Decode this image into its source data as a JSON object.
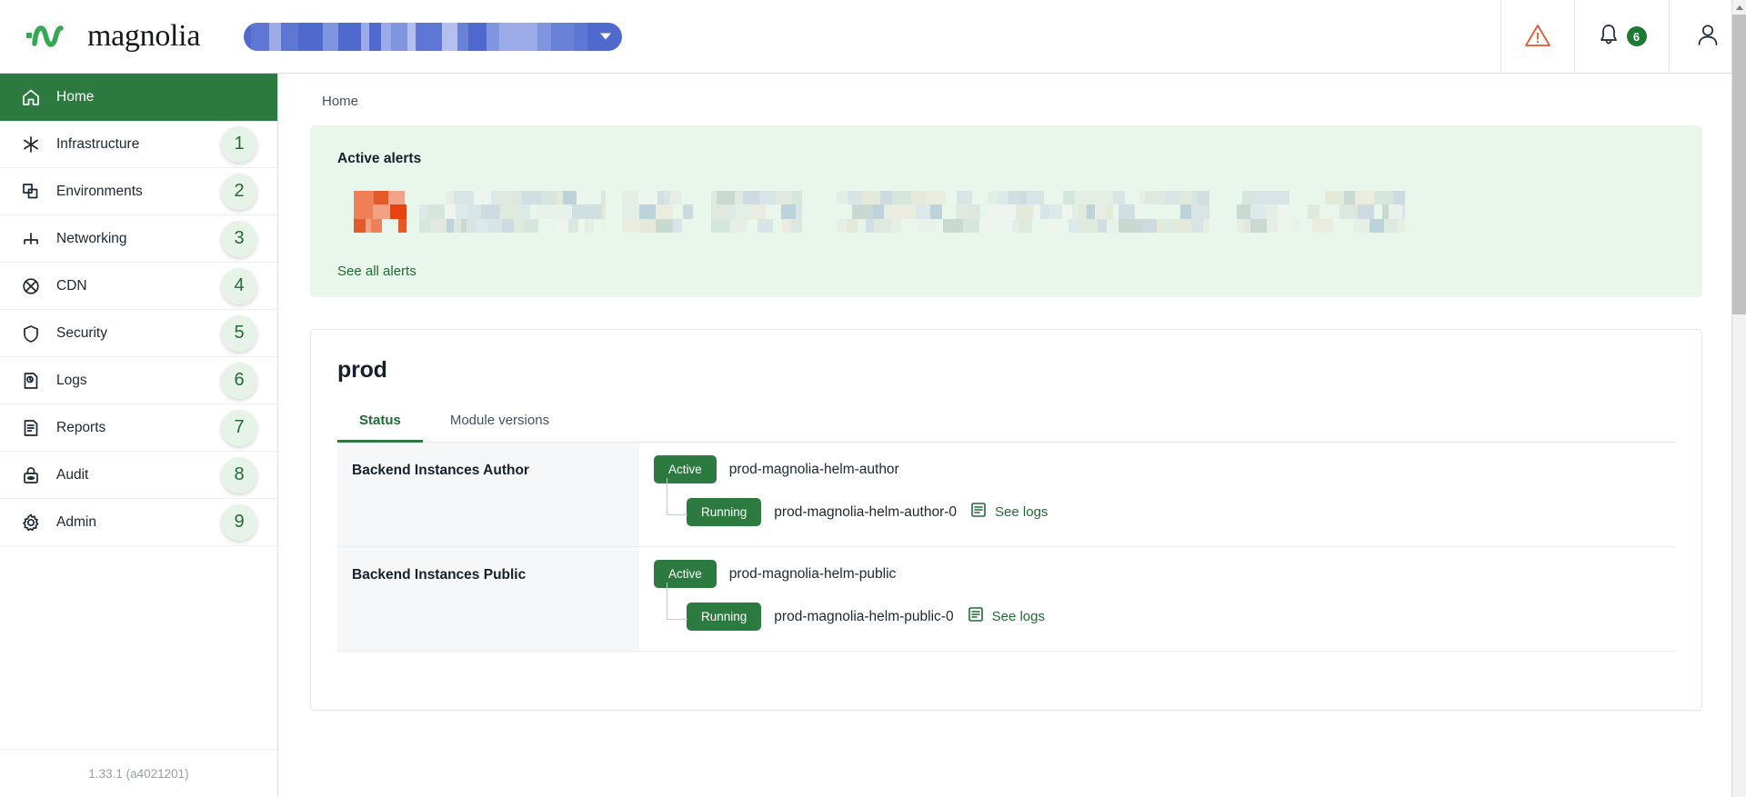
{
  "header": {
    "brand": "magnolia",
    "logo_icon": "magnolia-wave-logo",
    "env_selector": {
      "icon": "chevron-down-icon",
      "redacted": true,
      "color": "#4f69cd"
    },
    "warning_icon": "warning-triangle-icon",
    "warning_color": "#e8562a",
    "notifications_icon": "bell-icon",
    "notifications_count": "6",
    "notifications_badge_color": "#1d7a35",
    "account_icon": "user-avatar-icon"
  },
  "sidebar": {
    "items": [
      {
        "label": "Home",
        "icon": "home-icon",
        "badge": "",
        "active": true
      },
      {
        "label": "Infrastructure",
        "icon": "asterisk-icon",
        "badge": "1",
        "active": false
      },
      {
        "label": "Environments",
        "icon": "layers-icon",
        "badge": "2",
        "active": false
      },
      {
        "label": "Networking",
        "icon": "network-icon",
        "badge": "3",
        "active": false
      },
      {
        "label": "CDN",
        "icon": "globe-cross-icon",
        "badge": "4",
        "active": false
      },
      {
        "label": "Security",
        "icon": "shield-icon",
        "badge": "5",
        "active": false
      },
      {
        "label": "Logs",
        "icon": "log-file-icon",
        "badge": "6",
        "active": false
      },
      {
        "label": "Reports",
        "icon": "report-file-icon",
        "badge": "7",
        "active": false
      },
      {
        "label": "Audit",
        "icon": "lock-eye-icon",
        "badge": "8",
        "active": false
      },
      {
        "label": "Admin",
        "icon": "gear-icon",
        "badge": "9",
        "active": false
      }
    ],
    "version": "1.33.1 (a4021201)",
    "active_color": "#2c7a3f",
    "badge_bg": "#e7f3e9",
    "badge_color": "#226c33"
  },
  "main": {
    "breadcrumb": "Home",
    "alerts": {
      "title": "Active alerts",
      "see_all_label": "See all alerts",
      "card_bg": "#e9f6ec",
      "content_redacted": true
    },
    "environment": {
      "name": "prod",
      "tabs": [
        {
          "label": "Status",
          "active": true
        },
        {
          "label": "Module versions",
          "active": false
        }
      ],
      "rows": [
        {
          "name": "Backend Instances Author",
          "status_label": "Active",
          "resource": "prod-magnolia-helm-author",
          "child_status_label": "Running",
          "child_resource": "prod-magnolia-helm-author-0",
          "logs_label": "See logs",
          "logs_icon": "logs-icon"
        },
        {
          "name": "Backend Instances Public",
          "status_label": "Active",
          "resource": "prod-magnolia-helm-public",
          "child_status_label": "Running",
          "child_resource": "prod-magnolia-helm-public-0",
          "logs_label": "See logs",
          "logs_icon": "logs-icon"
        }
      ]
    }
  },
  "scrollbar": {
    "up_icon": "scroll-up-arrow-icon",
    "down_icon": "scroll-down-arrow-icon"
  }
}
